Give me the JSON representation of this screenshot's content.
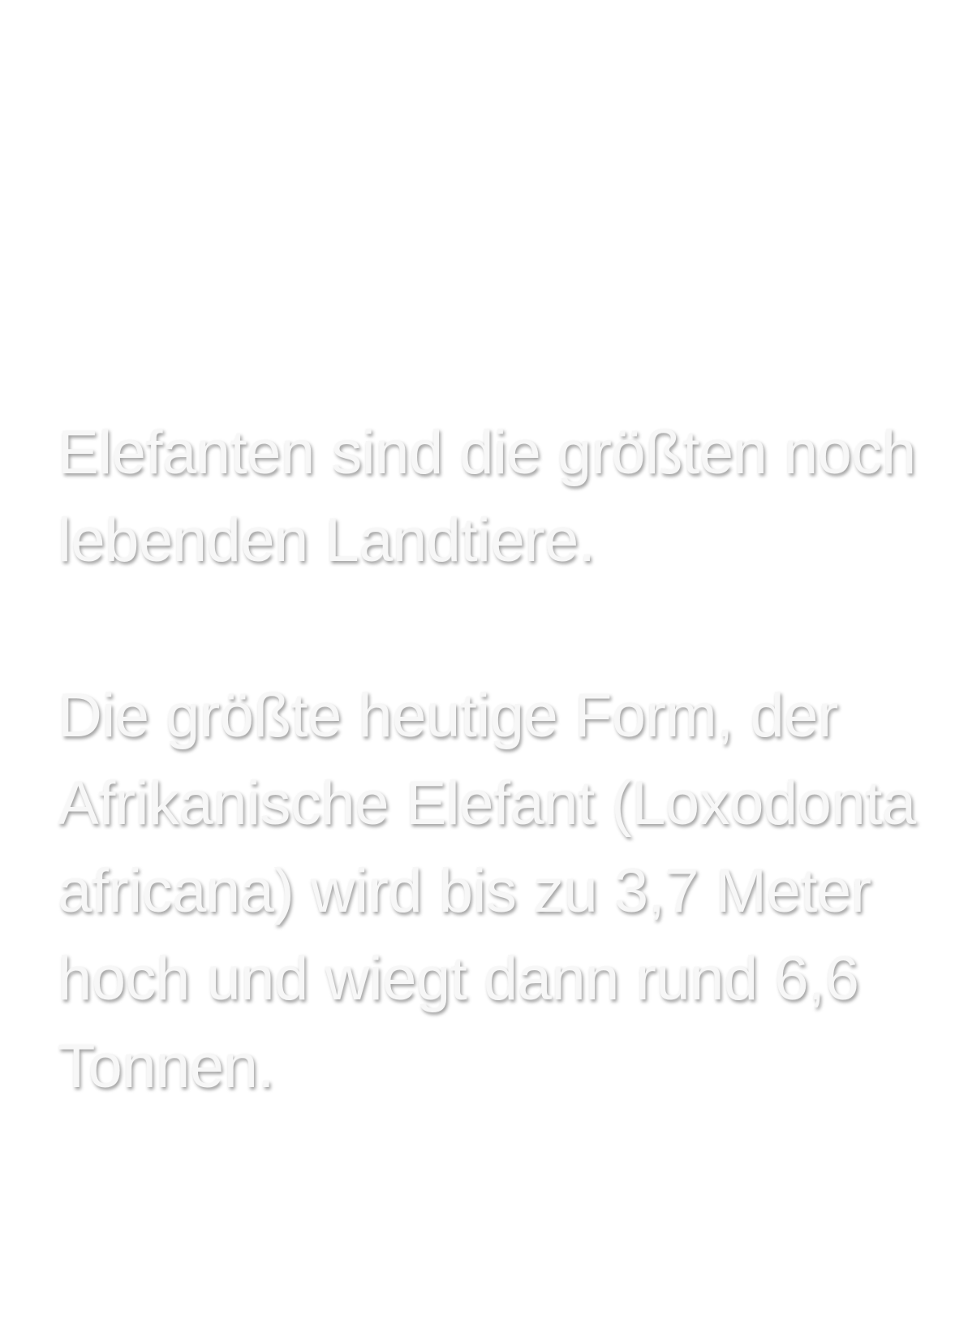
{
  "content": {
    "paragraphs": [
      {
        "lines": [
          "Elefanten sind die größten noch",
          "lebenden Landtiere."
        ]
      },
      {
        "lines": [
          "Die größte heutige Form, der",
          "Afrikanische Elefant (Loxodonta",
          "africana) wird bis zu 3,7 Meter",
          "hoch und wiegt dann rund 6,6",
          "Tonnen."
        ]
      }
    ]
  },
  "colors": {
    "background": "#ffffff",
    "text": "#f7f7f7"
  }
}
